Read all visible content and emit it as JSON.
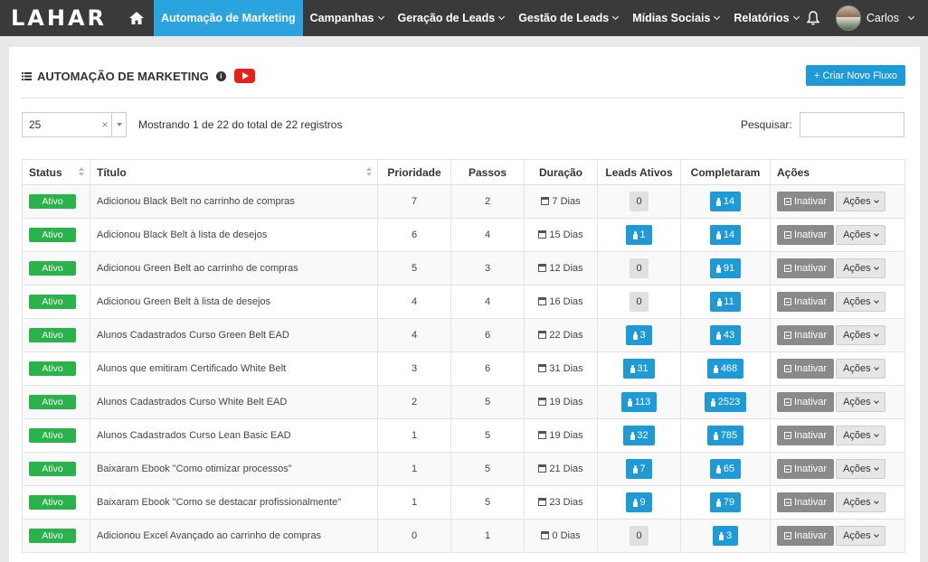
{
  "brand": "LAHAR",
  "nav": {
    "items": [
      {
        "label": "Automação de Marketing",
        "active": true
      },
      {
        "label": "Campanhas"
      },
      {
        "label": "Geração de Leads"
      },
      {
        "label": "Gestão de Leads"
      },
      {
        "label": "Mídias Sociais"
      },
      {
        "label": "Relatórios"
      }
    ],
    "user": "Carlos"
  },
  "page": {
    "title": "AUTOMAÇÃO DE MARKETING",
    "create_button": "+ Criar Novo Fluxo",
    "page_size": "25",
    "page_size_clear": "×",
    "showing": "Mostrando 1 de 22 do total de 22 registros",
    "search_label": "Pesquisar:"
  },
  "table": {
    "columns": [
      "Status",
      "Título",
      "Prioridade",
      "Passos",
      "Duração",
      "Leads Ativos",
      "Completaram",
      "Ações"
    ],
    "rows": [
      {
        "status": "Ativo",
        "title": "Adicionou Black Belt no carrinho de compras",
        "priority": "7",
        "steps": "2",
        "duration": "7 Dias",
        "active_leads": "0",
        "completed": "14"
      },
      {
        "status": "Ativo",
        "title": "Adicionou Black Belt à lista de desejos",
        "priority": "6",
        "steps": "4",
        "duration": "15 Dias",
        "active_leads": "1",
        "completed": "14"
      },
      {
        "status": "Ativo",
        "title": "Adicionou Green Belt ao carrinho de compras",
        "priority": "5",
        "steps": "3",
        "duration": "12 Dias",
        "active_leads": "0",
        "completed": "91"
      },
      {
        "status": "Ativo",
        "title": "Adicionou Green Belt à lista de desejos",
        "priority": "4",
        "steps": "4",
        "duration": "16 Dias",
        "active_leads": "0",
        "completed": "11"
      },
      {
        "status": "Ativo",
        "title": "Alunos Cadastrados Curso Green Belt EAD",
        "priority": "4",
        "steps": "6",
        "duration": "22 Dias",
        "active_leads": "3",
        "completed": "43"
      },
      {
        "status": "Ativo",
        "title": "Alunos que emitiram Certificado White Belt",
        "priority": "3",
        "steps": "6",
        "duration": "31 Dias",
        "active_leads": "31",
        "completed": "468"
      },
      {
        "status": "Ativo",
        "title": "Alunos Cadastrados Curso White Belt EAD",
        "priority": "2",
        "steps": "5",
        "duration": "19 Dias",
        "active_leads": "113",
        "completed": "2523"
      },
      {
        "status": "Ativo",
        "title": "Alunos Cadastrados Curso Lean Basic EAD",
        "priority": "1",
        "steps": "5",
        "duration": "19 Dias",
        "active_leads": "32",
        "completed": "785"
      },
      {
        "status": "Ativo",
        "title": "Baixaram Ebook \"Como otimizar processos\"",
        "priority": "1",
        "steps": "5",
        "duration": "21 Dias",
        "active_leads": "7",
        "completed": "65"
      },
      {
        "status": "Ativo",
        "title": "Baixaram Ebook \"Como se destacar profissionalmente\"",
        "priority": "1",
        "steps": "5",
        "duration": "23 Dias",
        "active_leads": "9",
        "completed": "79"
      },
      {
        "status": "Ativo",
        "title": "Adicionou Excel Avançado ao carrinho de compras",
        "priority": "0",
        "steps": "1",
        "duration": "0 Dias",
        "active_leads": "0",
        "completed": "3"
      }
    ],
    "inactivate_label": "Inativar",
    "actions_label": "Ações"
  },
  "colors": {
    "accent": "#2aa3df",
    "topbar": "#3a3a3a",
    "status_green": "#2ab24b",
    "youtube": "#e62117"
  }
}
